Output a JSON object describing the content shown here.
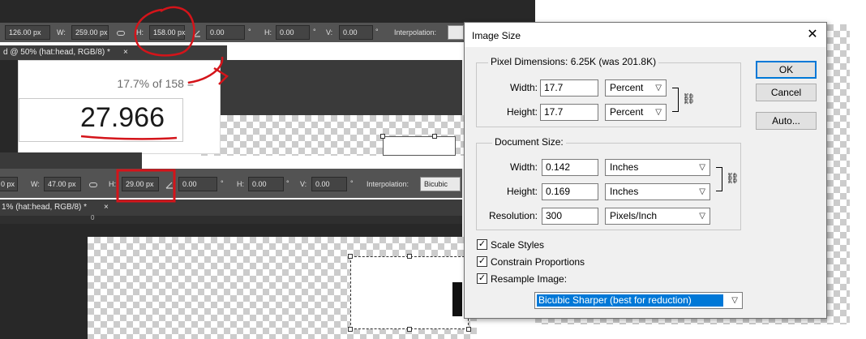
{
  "top_bar": {
    "w_label": "W:",
    "x_value": "126.00 px",
    "w_value": "259.00 px",
    "h_label": "H:",
    "h_value": "158.00 px",
    "angle_value": "0.00",
    "deg_symbol": "°",
    "hskew_label": "H:",
    "hskew_value": "0.00",
    "vskew_label": "V:",
    "vskew_value": "0.00",
    "interpolation_label": "Interpolation:",
    "tab_label": "d @ 50% (hat:head, RGB/8) *",
    "tab_close": "×"
  },
  "calc": {
    "expression": "17.7% of 158 =",
    "result": "27.966"
  },
  "bottom_bar": {
    "x_value": "0 px",
    "w_label": "W:",
    "w_value": "47.00 px",
    "h_label": "H:",
    "h_value": "29.00 px",
    "angle_value": "0.00",
    "deg_symbol": "°",
    "hskew_label": "H:",
    "hskew_value": "0.00",
    "vskew_label": "V:",
    "vskew_value": "0.00",
    "interpolation_label": "Interpolation:",
    "interpolation_value": "Bicubic",
    "tab_label": "1% (hat:head, RGB/8) *",
    "tab_close": "×",
    "ruler_zero": "0"
  },
  "dialog": {
    "title": "Image Size",
    "close": "✕",
    "pixel_dimensions": {
      "title": "Pixel Dimensions:  6.25K (was 201.8K)",
      "width_label": "Width:",
      "width_value": "17.7",
      "width_unit": "Percent",
      "height_label": "Height:",
      "height_value": "17.7",
      "height_unit": "Percent"
    },
    "document_size": {
      "title": "Document Size:",
      "width_label": "Width:",
      "width_value": "0.142",
      "width_unit": "Inches",
      "height_label": "Height:",
      "height_value": "0.169",
      "height_unit": "Inches",
      "resolution_label": "Resolution:",
      "resolution_value": "300",
      "resolution_unit": "Pixels/Inch"
    },
    "buttons": {
      "ok": "OK",
      "cancel": "Cancel",
      "auto": "Auto..."
    },
    "options": {
      "scale_styles": "Scale Styles",
      "constrain": "Constrain Proportions",
      "resample": "Resample Image:",
      "resample_method": "Bicubic Sharper (best for reduction)",
      "check": "✓"
    }
  },
  "colors": {
    "annotation_red": "#d4141a",
    "ps_panel": "#535353",
    "ps_dark": "#282828",
    "dialog_bg": "#f0f0f0",
    "selection_blue": "#0078d7"
  },
  "icons": {
    "chain": "chain-link-icon",
    "angle": "angle-icon",
    "chevron": "chevron-down-icon"
  }
}
